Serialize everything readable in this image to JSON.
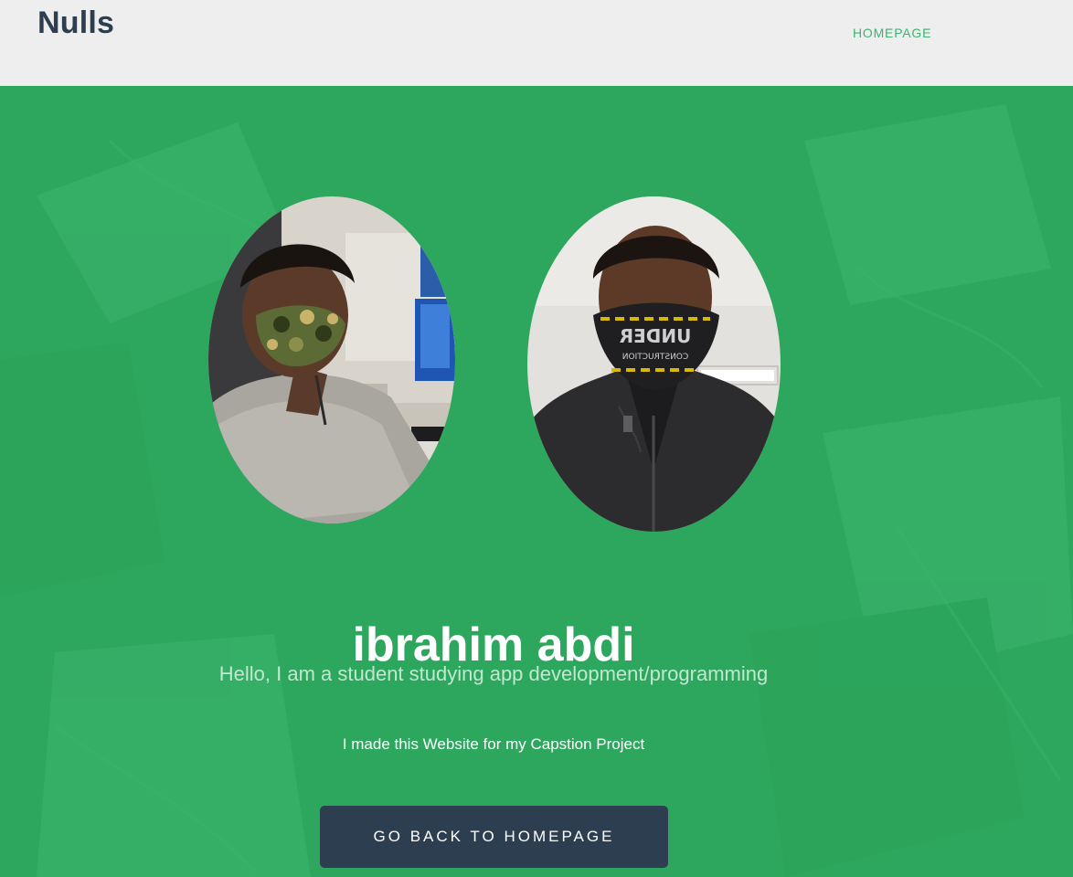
{
  "header": {
    "brand": "Nulls",
    "nav": {
      "homepage_label": "HOMEPAGE"
    }
  },
  "hero": {
    "name": "ibrahim abdi",
    "subtitle": "Hello, I am a student studying app development/programming",
    "note": "I made this Website for my Capstion Project",
    "cta_label": "GO BACK TO HOMEPAGE"
  },
  "colors": {
    "header_bg": "#eeeeee",
    "brand_text": "#2c3e50",
    "nav_link": "#3cb371",
    "hero_bg": "#2fa85f",
    "subtitle_text": "#bfe8cf",
    "button_bg": "#2c3e50",
    "button_text": "#ffffff"
  }
}
